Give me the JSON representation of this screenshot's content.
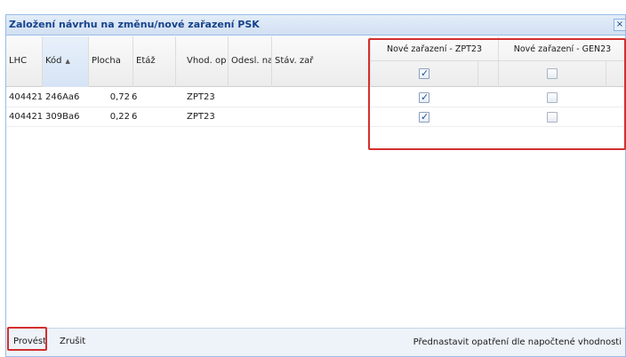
{
  "dialog": {
    "title": "Založení návrhu na změnu/nové zařazení PSK",
    "close_glyph": "×"
  },
  "columns": {
    "lhc": "LHC",
    "kod": "Kód",
    "plocha": "Plocha",
    "etaz": "Etáž",
    "vhod": "Vhod. op",
    "odesl": "Odesl. na",
    "stav": "Stáv. zař"
  },
  "groups": [
    {
      "label": "Nové zařazení - ZPT23",
      "header_checked": true
    },
    {
      "label": "Nové zařazení - GEN23",
      "header_checked": false
    }
  ],
  "rows": [
    {
      "lhc": "404421",
      "kod": "246Aa6",
      "plocha": "0,72",
      "etaz": "6",
      "vhod": "ZPT23",
      "odesl": "",
      "stav": "",
      "zpt23": true,
      "gen23": false
    },
    {
      "lhc": "404421",
      "kod": "309Ba6",
      "plocha": "0,22",
      "etaz": "6",
      "vhod": "ZPT23",
      "odesl": "",
      "stav": "",
      "zpt23": true,
      "gen23": false
    }
  ],
  "sort_indicator": "▲",
  "footer": {
    "execute_label": "Provést",
    "cancel_label": "Zrušit",
    "preset_label": "Přednastavit opatření dle napočtené vhodnosti"
  }
}
